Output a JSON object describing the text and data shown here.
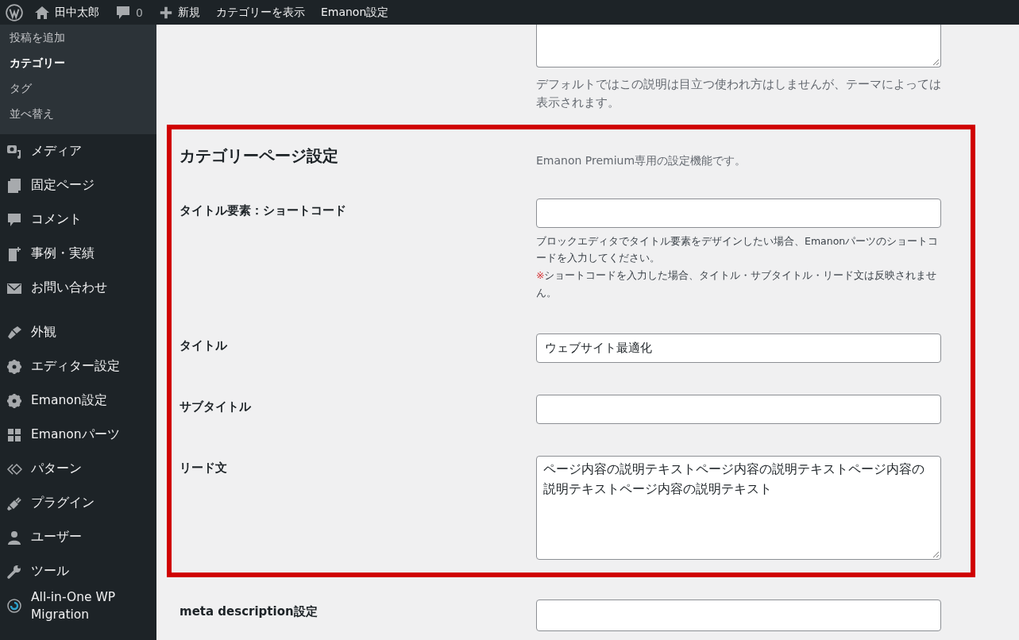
{
  "admin_bar": {
    "site_name": "田中太郎",
    "comments_count": "0",
    "new_label": "新規",
    "links": [
      "カテゴリーを表示",
      "Emanon設定"
    ]
  },
  "sidebar": {
    "submenu": [
      {
        "label": "投稿を追加",
        "selected": false
      },
      {
        "label": "カテゴリー",
        "selected": true
      },
      {
        "label": "タグ",
        "selected": false
      },
      {
        "label": "並べ替え",
        "selected": false
      }
    ],
    "menu_groups": [
      [
        "メディア",
        "固定ページ",
        "コメント",
        "事例・実績",
        "お問い合わせ"
      ],
      [
        "外観",
        "エディター設定",
        "Emanon設定",
        "Emanonパーツ",
        "パターン",
        "プラグイン",
        "ユーザー",
        "ツール",
        "All-in-One WP Migration"
      ]
    ]
  },
  "description_help": "デフォルトではこの説明は目立つ使われ方はしませんが、テーマによっては表示されます。",
  "category_page_settings": {
    "title": "カテゴリーページ設定",
    "note": "Emanon Premium専用の設定機能です。",
    "fields": [
      {
        "label": "タイトル要素：ショートコード",
        "kind": "input",
        "help": "ブロックエディタでタイトル要素をデザインしたい場合、Emanonパーツのショートコードを入力してください。",
        "warning_mark": "※",
        "warning": "ショートコードを入力した場合、タイトル・サブタイトル・リード文は反映されません。"
      },
      {
        "label": "タイトル",
        "kind": "input",
        "value": "ウェブサイト最適化"
      },
      {
        "label": "サブタイトル",
        "kind": "input"
      },
      {
        "label": "リード文",
        "kind": "textarea",
        "value": "ページ内容の説明テキストページ内容の説明テキストページ内容の説明テキストページ内容の説明テキスト"
      }
    ]
  },
  "meta_description": {
    "label": "meta description設定"
  }
}
